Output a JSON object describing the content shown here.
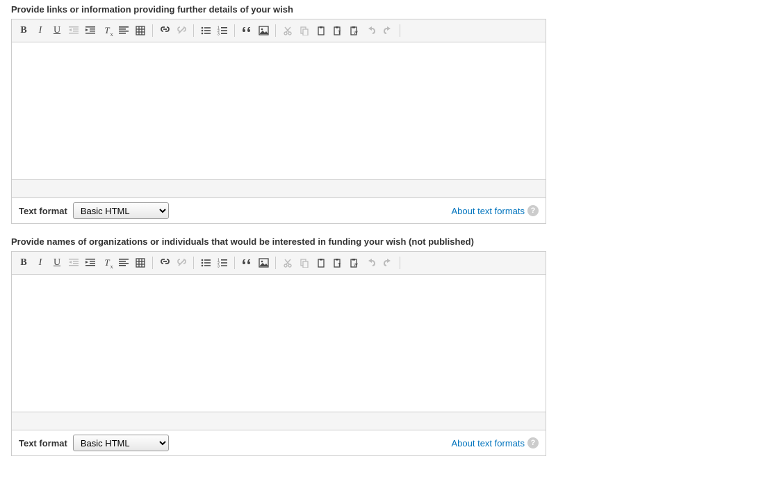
{
  "fields": [
    {
      "label": "Provide links or information providing further details of your wish"
    },
    {
      "label": "Provide names of organizations or individuals that would be interested in funding your wish (not published)"
    }
  ],
  "format": {
    "label": "Text format",
    "selected": "Basic HTML",
    "about_label": "About text formats"
  },
  "toolbar": {
    "bold": "B",
    "italic": "I",
    "underline": "U",
    "remove_format": "T"
  }
}
